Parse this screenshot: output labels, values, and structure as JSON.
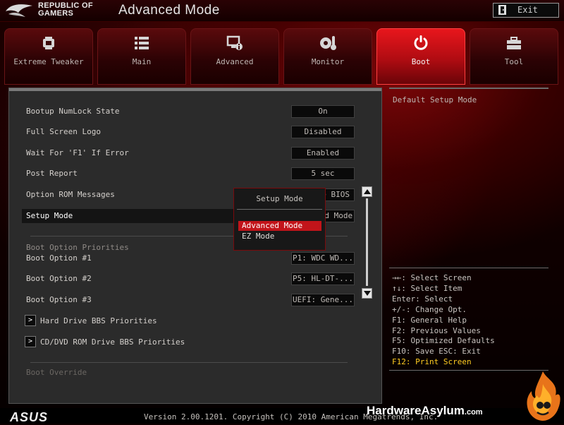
{
  "header": {
    "brand_line1": "REPUBLIC OF",
    "brand_line2": "GAMERS",
    "title": "Advanced Mode",
    "exit_label": "Exit"
  },
  "tabs": [
    {
      "label": "Extreme Tweaker",
      "icon": "tweaker-icon"
    },
    {
      "label": "Main",
      "icon": "list-icon"
    },
    {
      "label": "Advanced",
      "icon": "advanced-icon"
    },
    {
      "label": "Monitor",
      "icon": "thermometer-icon"
    },
    {
      "label": "Boot",
      "icon": "power-icon",
      "active": true
    },
    {
      "label": "Tool",
      "icon": "toolbox-icon"
    }
  ],
  "settings": [
    {
      "label": "Bootup NumLock State",
      "value": "On"
    },
    {
      "label": "Full Screen Logo",
      "value": "Disabled"
    },
    {
      "label": "Wait For 'F1' If Error",
      "value": "Enabled"
    },
    {
      "label": "Post Report",
      "value": "5 sec"
    },
    {
      "label": "Option ROM Messages",
      "value": "Force BIOS"
    },
    {
      "label": "Setup Mode",
      "value": "Advanced Mode"
    }
  ],
  "boot_section": {
    "title": "Boot Option Priorities",
    "options": [
      {
        "label": "Boot Option #1",
        "value": "P1: WDC WD..."
      },
      {
        "label": "Boot Option #2",
        "value": "P5: HL-DT-..."
      },
      {
        "label": "Boot Option #3",
        "value": "UEFI: Gene..."
      }
    ],
    "submenus": [
      "Hard Drive BBS Priorities",
      "CD/DVD ROM Drive BBS Priorities"
    ],
    "override_label": "Boot Override"
  },
  "popup": {
    "title": "Setup Mode",
    "options": [
      "Advanced Mode",
      "EZ Mode"
    ],
    "selected": 0
  },
  "help": {
    "description": "Default Setup Mode",
    "keys": [
      "→←: Select Screen",
      "↑↓: Select Item",
      "Enter: Select",
      "+/-: Change Opt.",
      "F1: General Help",
      "F2: Previous Values",
      "F5: Optimized Defaults",
      "F10: Save  ESC: Exit",
      "F12: Print Screen"
    ]
  },
  "footer": {
    "logo": "ASUS",
    "version": "Version 2.00.1201. Copyright (C) 2010 American Megatrends, Inc.",
    "watermark": "HardwareAsylum",
    "watermark_suffix": ".com"
  },
  "colors": {
    "accent": "#c2141a",
    "active_tab": "#e8161c",
    "highlight_key": "#ffcc22"
  }
}
